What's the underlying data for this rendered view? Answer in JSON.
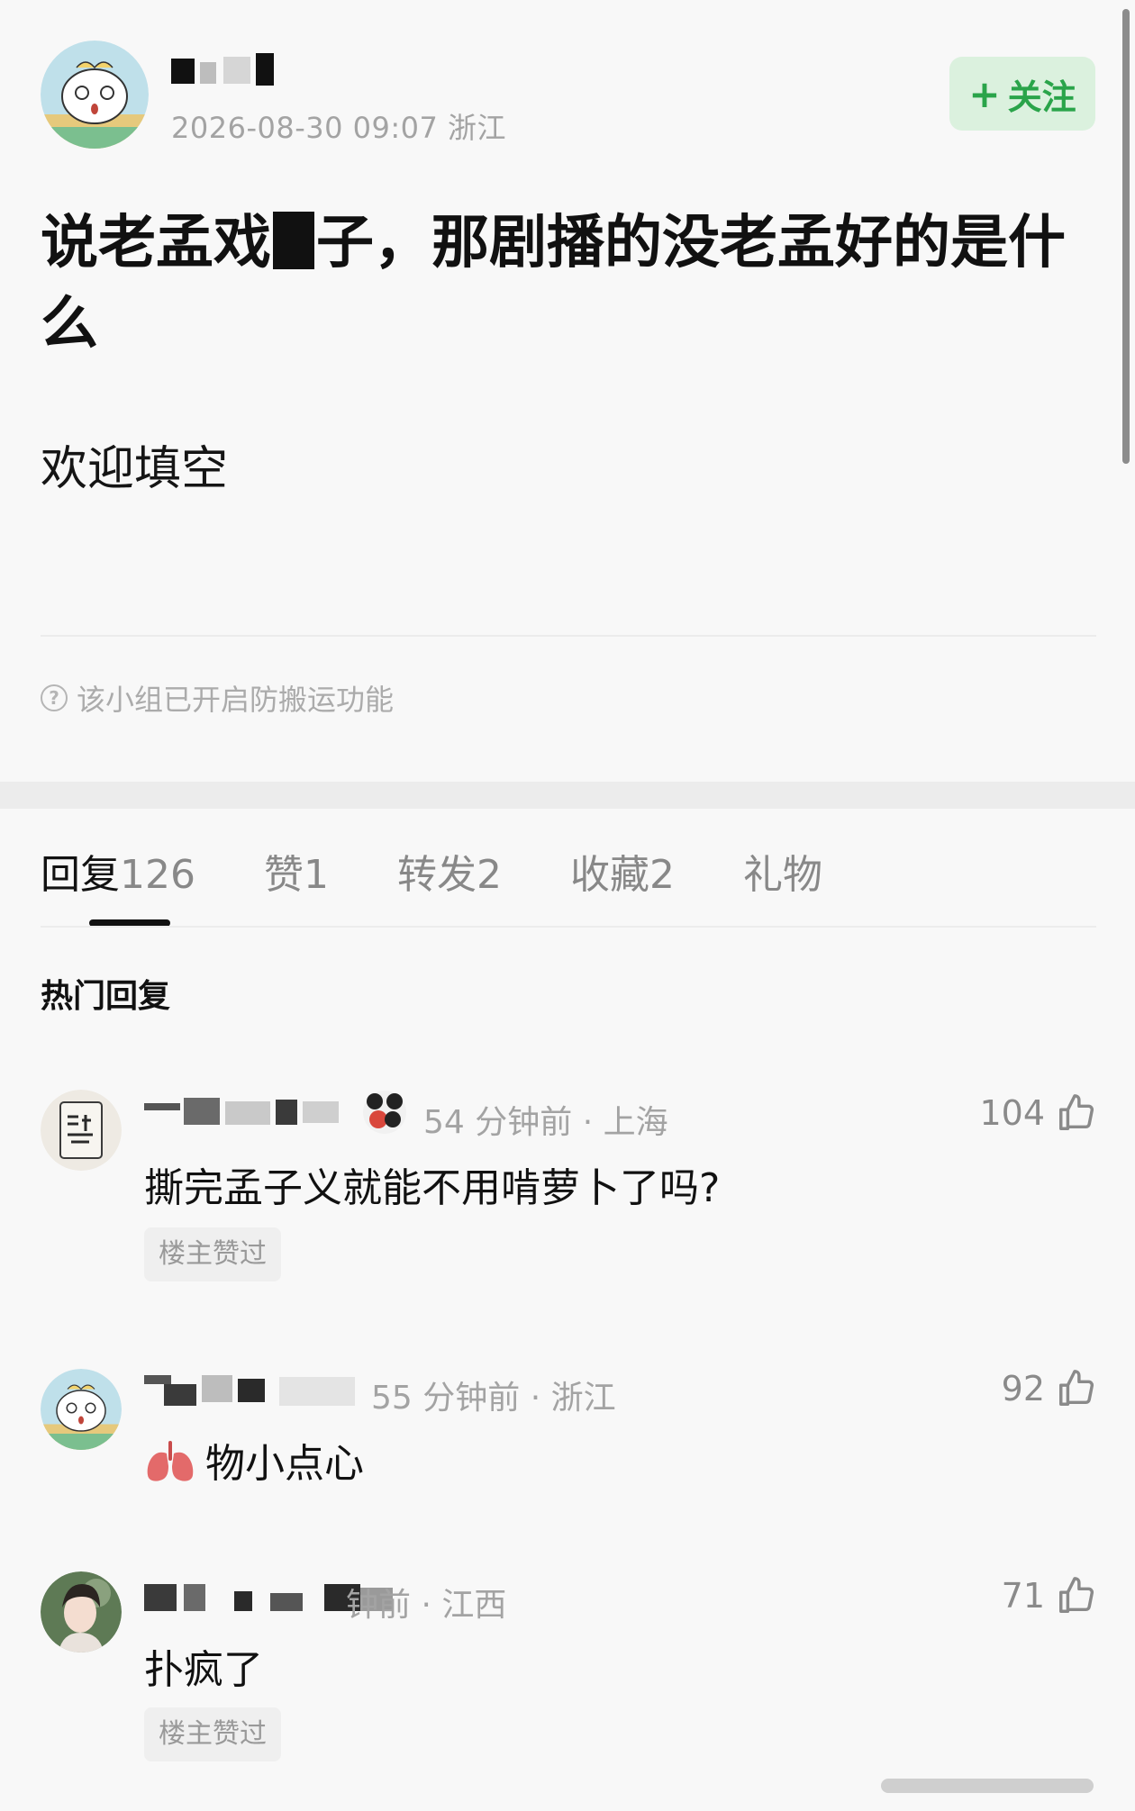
{
  "post": {
    "author_meta": "2026-08-30 09:07  浙江",
    "follow_label": "关注",
    "follow_icon": "plus-icon",
    "title_part1": "说老孟戏",
    "title_part2": "子，那剧播的没老孟好的是什么",
    "body": "欢迎填空",
    "notice": "该小组已开启防搬运功能",
    "notice_icon": "question-circle-icon"
  },
  "tabs": [
    {
      "label": "回复",
      "count": "126"
    },
    {
      "label": "赞",
      "count": "1"
    },
    {
      "label": "转发",
      "count": "2"
    },
    {
      "label": "收藏",
      "count": "2"
    },
    {
      "label": "礼物",
      "count": ""
    }
  ],
  "hot_label": "热门回复",
  "comments": [
    {
      "meta": "54 分钟前 · 上海",
      "text": "撕完孟子义就能不用啃萝卜了吗?",
      "likes": "104",
      "badge": "楼主赞过"
    },
    {
      "meta": "55 分钟前 · 浙江",
      "text": "物小点心",
      "likes": "92",
      "badge": ""
    },
    {
      "meta": "钟前 · 江西",
      "text": "扑疯了",
      "likes": "71",
      "badge": "楼主赞过"
    }
  ],
  "colors": {
    "accent_green": "#2aa44a",
    "follow_bg": "#dbf1de",
    "muted": "#a3a3a3"
  }
}
